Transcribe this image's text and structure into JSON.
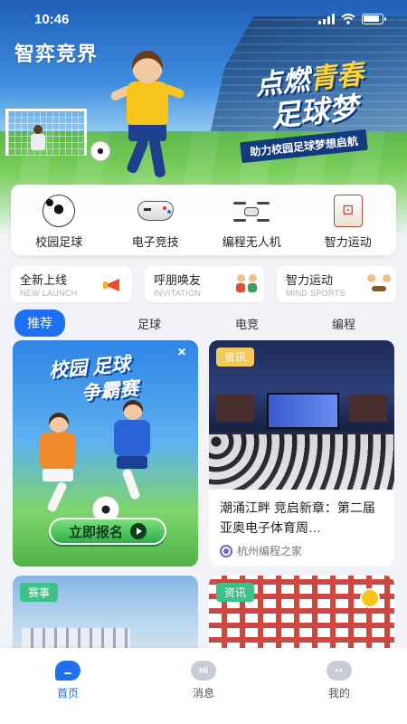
{
  "status_bar": {
    "time": "10:46"
  },
  "hero": {
    "brand": "智弈竞界",
    "slogan_part1": "点燃",
    "slogan_part1_accent": "青春",
    "slogan_line2": "足球梦",
    "tagline": "助力校园足球梦想启航"
  },
  "categories": [
    {
      "label": "校园足球",
      "icon": "soccer-ball-icon"
    },
    {
      "label": "电子竞技",
      "icon": "gamepad-icon"
    },
    {
      "label": "编程无人机",
      "icon": "drone-icon"
    },
    {
      "label": "智力运动",
      "icon": "chess-tile-icon"
    }
  ],
  "features": [
    {
      "title": "全新上线",
      "subtitle": "NEW LAUNCH",
      "icon": "megaphone-icon"
    },
    {
      "title": "呼朋唤友",
      "subtitle": "INVITATION",
      "icon": "friends-icon"
    },
    {
      "title": "智力运动",
      "subtitle": "MIND SPORTS",
      "icon": "board-game-icon"
    }
  ],
  "tabs": [
    {
      "label": "推荐",
      "active": true
    },
    {
      "label": "足球",
      "active": false
    },
    {
      "label": "电竞",
      "active": false
    },
    {
      "label": "编程",
      "active": false
    }
  ],
  "feed": {
    "promo": {
      "title_line1": "校园 足球",
      "title_line2": "争霸赛",
      "close": "×",
      "button": "立即报名"
    },
    "news": {
      "tag": "资讯",
      "title": "潮涌江畔 竞启新章：第二届亚奥电子体育周…",
      "source": "杭州编程之家"
    },
    "row2": [
      {
        "tag": "赛事"
      },
      {
        "tag": "资讯"
      }
    ]
  },
  "bottom_nav": [
    {
      "label": "首页",
      "icon_text": "",
      "active": true
    },
    {
      "label": "消息",
      "icon_text": "Hi",
      "active": false
    },
    {
      "label": "我的",
      "icon_text": "••",
      "active": false
    }
  ],
  "colors": {
    "accent": "#1e6ff2",
    "tag_yellow": "#f3c75a",
    "tag_green": "#3dc08a"
  }
}
